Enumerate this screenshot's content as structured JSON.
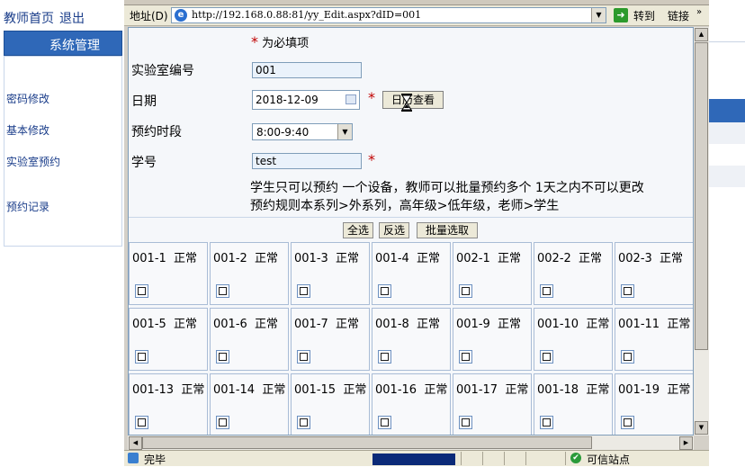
{
  "background": {
    "nav_top": [
      "教师首页",
      "退出"
    ],
    "system_header": "系统管理",
    "menu_items": [
      "密码修改",
      "基本修改",
      "实验室预约",
      "预约记录"
    ]
  },
  "address_bar": {
    "label": "地址(D)",
    "url": "http://192.168.0.88:81/yy_Edit.aspx?dID=001",
    "go_label": "转到",
    "links_label": "链接",
    "links_arrow": "»"
  },
  "form": {
    "required_star": "*",
    "required_note": "为必填项",
    "lab_id_label": "实验室编号",
    "lab_id_value": "001",
    "date_label": "日期",
    "date_value": "2018-12-09",
    "view_button": "日历查看",
    "period_label": "预约时段",
    "period_value": "8:00-9:40",
    "student_no_label": "学号",
    "student_no_value": "test",
    "note_line1": "学生只可以预约 一个设备，教师可以批量预约多个  1天之内不可以更改",
    "note_line2": "预约规则本系列>外系列，高年级>低年级，老师>学生"
  },
  "actions": {
    "select_all": "全选",
    "invert": "反选",
    "batch": "批量选取"
  },
  "devices": [
    {
      "id": "001-1",
      "status": "正常"
    },
    {
      "id": "001-2",
      "status": "正常"
    },
    {
      "id": "001-3",
      "status": "正常"
    },
    {
      "id": "001-4",
      "status": "正常"
    },
    {
      "id": "002-1",
      "status": "正常"
    },
    {
      "id": "002-2",
      "status": "正常"
    },
    {
      "id": "002-3",
      "status": "正常"
    },
    {
      "id": "001-5",
      "status": "正常"
    },
    {
      "id": "001-6",
      "status": "正常"
    },
    {
      "id": "001-7",
      "status": "正常"
    },
    {
      "id": "001-8",
      "status": "正常"
    },
    {
      "id": "001-9",
      "status": "正常"
    },
    {
      "id": "001-10",
      "status": "正常"
    },
    {
      "id": "001-11",
      "status": "正常"
    },
    {
      "id": "001-13",
      "status": "正常"
    },
    {
      "id": "001-14",
      "status": "正常"
    },
    {
      "id": "001-15",
      "status": "正常"
    },
    {
      "id": "001-16",
      "status": "正常"
    },
    {
      "id": "001-17",
      "status": "正常"
    },
    {
      "id": "001-18",
      "status": "正常"
    },
    {
      "id": "001-19",
      "status": "正常"
    }
  ],
  "status_bar": {
    "text": "完毕",
    "zone": "可信站点"
  },
  "colors": {
    "accent": "#2f68b8",
    "required": "#c00000",
    "input_bg": "#eaf2fb",
    "progress": "#0b2a78"
  }
}
